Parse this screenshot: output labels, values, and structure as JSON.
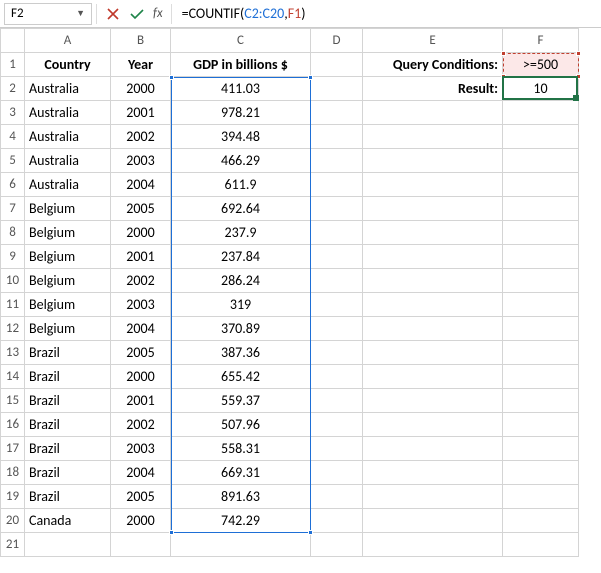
{
  "nameBox": "F2",
  "formula": {
    "prefix": "=COUNTIF(",
    "ref1": "C2:C20",
    "sep": ",",
    "ref2": "F1",
    "suffix": ")"
  },
  "columns": [
    "A",
    "B",
    "C",
    "D",
    "E",
    "F"
  ],
  "headers": {
    "country": "Country",
    "year": "Year",
    "gdp": "GDP in billions $",
    "queryLabel": "Query Conditions:",
    "resultLabel": "Result:"
  },
  "query": {
    "condition": ">=500",
    "result": "10"
  },
  "rows": [
    {
      "country": "Australia",
      "year": "2000",
      "gdp": "411.03"
    },
    {
      "country": "Australia",
      "year": "2001",
      "gdp": "978.21"
    },
    {
      "country": "Australia",
      "year": "2002",
      "gdp": "394.48"
    },
    {
      "country": "Australia",
      "year": "2003",
      "gdp": "466.29"
    },
    {
      "country": "Australia",
      "year": "2004",
      "gdp": "611.9"
    },
    {
      "country": "Belgium",
      "year": "2005",
      "gdp": "692.64"
    },
    {
      "country": "Belgium",
      "year": "2000",
      "gdp": "237.9"
    },
    {
      "country": "Belgium",
      "year": "2001",
      "gdp": "237.84"
    },
    {
      "country": "Belgium",
      "year": "2002",
      "gdp": "286.24"
    },
    {
      "country": "Belgium",
      "year": "2003",
      "gdp": "319"
    },
    {
      "country": "Belgium",
      "year": "2004",
      "gdp": "370.89"
    },
    {
      "country": "Brazil",
      "year": "2005",
      "gdp": "387.36"
    },
    {
      "country": "Brazil",
      "year": "2000",
      "gdp": "655.42"
    },
    {
      "country": "Brazil",
      "year": "2001",
      "gdp": "559.37"
    },
    {
      "country": "Brazil",
      "year": "2002",
      "gdp": "507.96"
    },
    {
      "country": "Brazil",
      "year": "2003",
      "gdp": "558.31"
    },
    {
      "country": "Brazil",
      "year": "2004",
      "gdp": "669.31"
    },
    {
      "country": "Brazil",
      "year": "2005",
      "gdp": "891.63"
    },
    {
      "country": "Canada",
      "year": "2000",
      "gdp": "742.29"
    }
  ],
  "extraBlankRows": [
    21
  ]
}
